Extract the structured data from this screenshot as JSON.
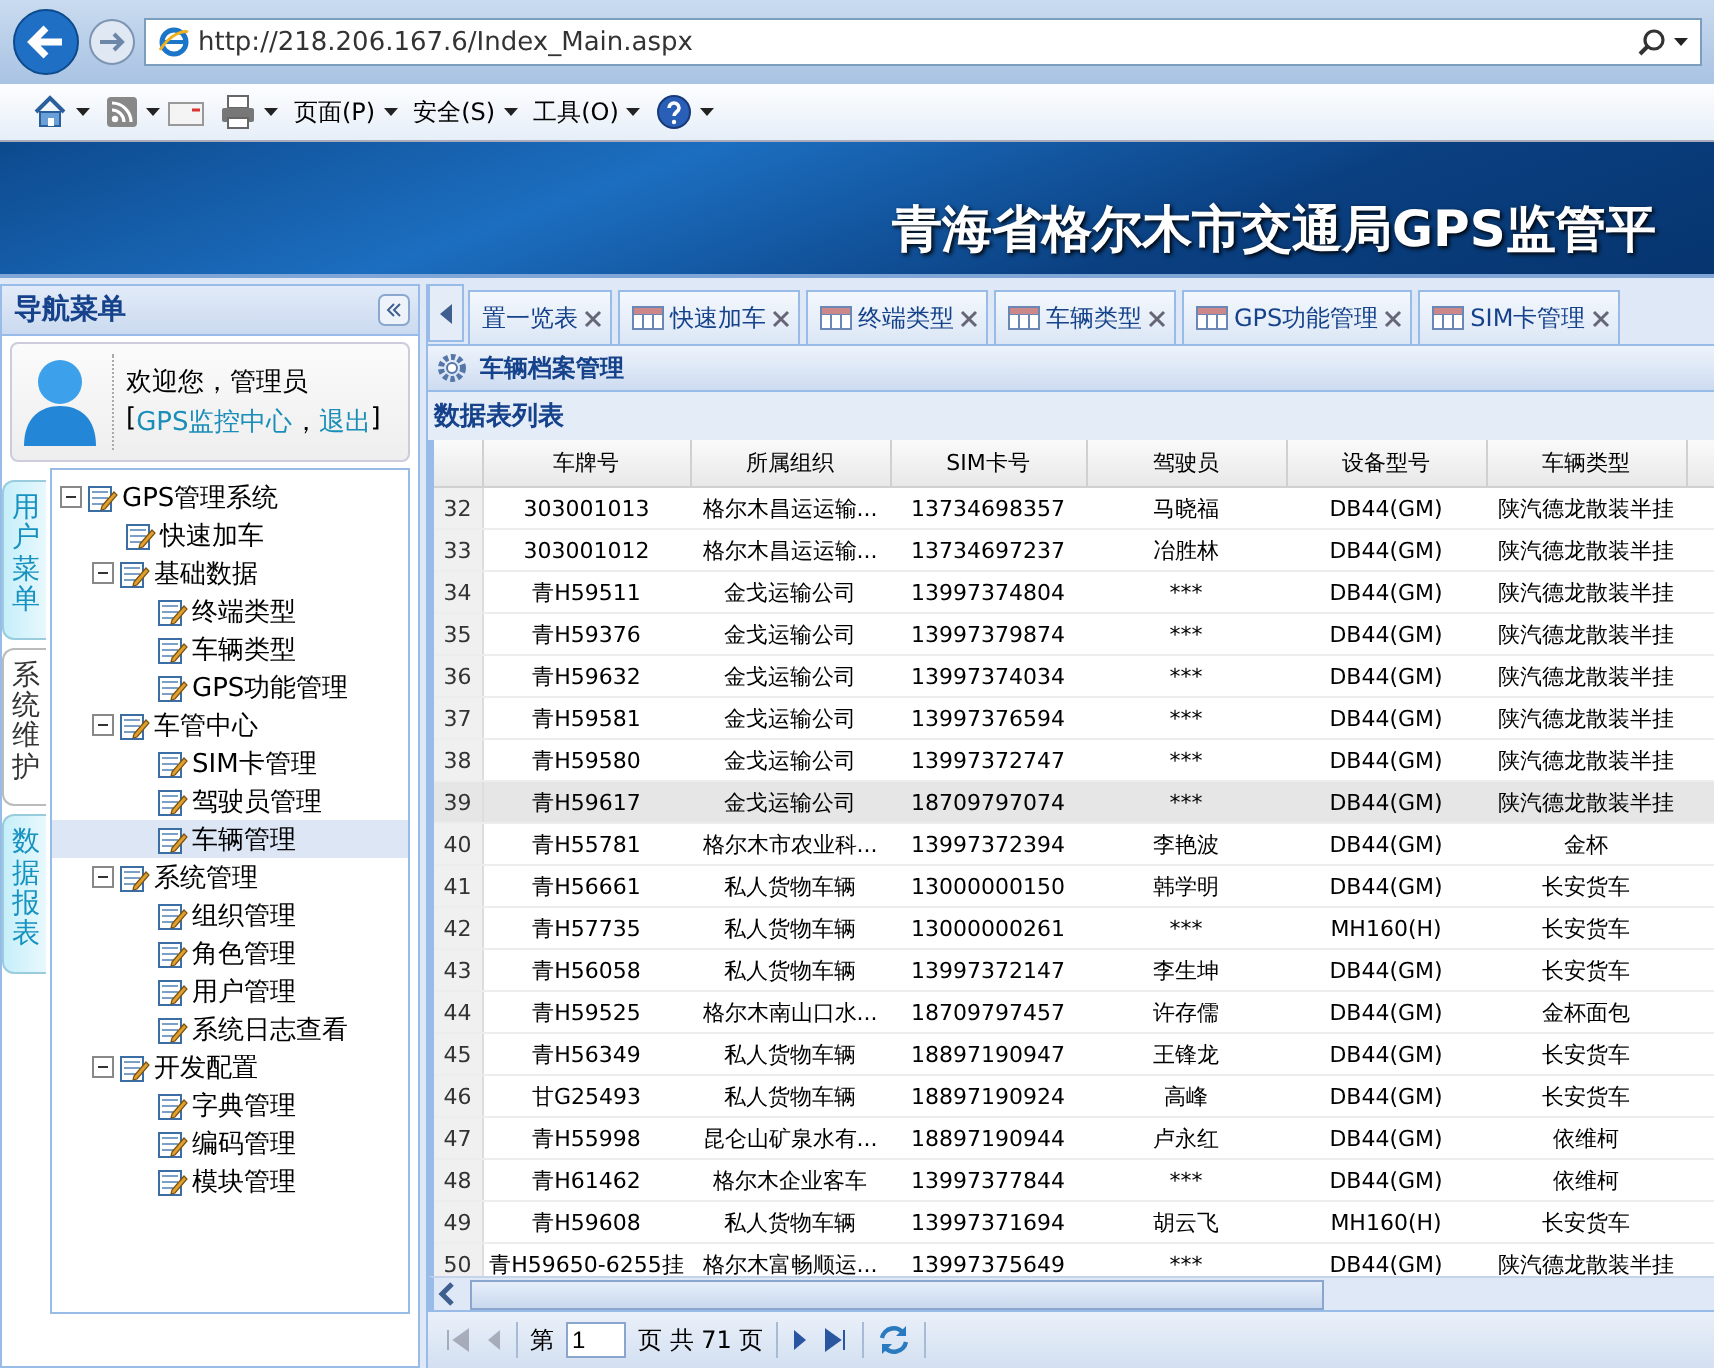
{
  "browser": {
    "url": "http://218.206.167.6/Index_Main.aspx",
    "menus": [
      {
        "label": "页面(P)"
      },
      {
        "label": "安全(S)"
      },
      {
        "label": "工具(O)"
      }
    ]
  },
  "banner": {
    "title": "青海省格尔木市交通局GPS监管平"
  },
  "nav": {
    "title": "导航菜单",
    "greeting": "欢迎您，管理员",
    "bracket_open": "[",
    "center_link": "GPS监控中心",
    "separator": "，",
    "logout_link": "退出",
    "bracket_close": "]",
    "side_tabs": [
      {
        "label": "用户菜单",
        "selected": false
      },
      {
        "label": "系统维护",
        "selected": true
      },
      {
        "label": "数据报表",
        "selected": false
      }
    ],
    "tree": [
      {
        "label": "GPS管理系统",
        "selected": false,
        "expanded": true,
        "children": [
          {
            "label": "快速加车",
            "selected": false
          },
          {
            "label": "基础数据",
            "selected": false,
            "expanded": true,
            "children": [
              {
                "label": "终端类型",
                "selected": false
              },
              {
                "label": "车辆类型",
                "selected": false
              },
              {
                "label": "GPS功能管理",
                "selected": false
              }
            ]
          },
          {
            "label": "车管中心",
            "selected": false,
            "expanded": true,
            "children": [
              {
                "label": "SIM卡管理",
                "selected": false
              },
              {
                "label": "驾驶员管理",
                "selected": false
              },
              {
                "label": "车辆管理",
                "selected": true
              }
            ]
          },
          {
            "label": "系统管理",
            "selected": false,
            "expanded": true,
            "children": [
              {
                "label": "组织管理",
                "selected": false
              },
              {
                "label": "角色管理",
                "selected": false
              },
              {
                "label": "用户管理",
                "selected": false
              },
              {
                "label": "系统日志查看",
                "selected": false
              }
            ]
          },
          {
            "label": "开发配置",
            "selected": false,
            "expanded": true,
            "children": [
              {
                "label": "字典管理",
                "selected": false
              },
              {
                "label": "编码管理",
                "selected": false
              },
              {
                "label": "模块管理",
                "selected": false
              }
            ]
          }
        ]
      }
    ]
  },
  "tabs": [
    {
      "label": "置一览表",
      "selected": false
    },
    {
      "label": "快速加车",
      "selected": false
    },
    {
      "label": "终端类型",
      "selected": false
    },
    {
      "label": "车辆类型",
      "selected": false
    },
    {
      "label": "GPS功能管理",
      "selected": false
    },
    {
      "label": "SIM卡管理",
      "selected": false
    }
  ],
  "panel": {
    "title": "车辆档案管理",
    "subtitle": "数据表列表"
  },
  "table": {
    "columns": [
      "车牌号",
      "所属组织",
      "SIM卡号",
      "驾驶员",
      "设备型号",
      "车辆类型"
    ],
    "rows": [
      {
        "n": "32",
        "selected": false,
        "cells": [
          "303001013",
          "格尔木昌运运输...",
          "13734698357",
          "马晓福",
          "DB44(GM)",
          "陕汽德龙散装半挂"
        ]
      },
      {
        "n": "33",
        "selected": false,
        "cells": [
          "303001012",
          "格尔木昌运运输...",
          "13734697237",
          "冶胜林",
          "DB44(GM)",
          "陕汽德龙散装半挂"
        ]
      },
      {
        "n": "34",
        "selected": false,
        "cells": [
          "青H59511",
          "金戈运输公司",
          "13997374804",
          "***",
          "DB44(GM)",
          "陕汽德龙散装半挂"
        ]
      },
      {
        "n": "35",
        "selected": false,
        "cells": [
          "青H59376",
          "金戈运输公司",
          "13997379874",
          "***",
          "DB44(GM)",
          "陕汽德龙散装半挂"
        ]
      },
      {
        "n": "36",
        "selected": false,
        "cells": [
          "青H59632",
          "金戈运输公司",
          "13997374034",
          "***",
          "DB44(GM)",
          "陕汽德龙散装半挂"
        ]
      },
      {
        "n": "37",
        "selected": false,
        "cells": [
          "青H59581",
          "金戈运输公司",
          "13997376594",
          "***",
          "DB44(GM)",
          "陕汽德龙散装半挂"
        ]
      },
      {
        "n": "38",
        "selected": false,
        "cells": [
          "青H59580",
          "金戈运输公司",
          "13997372747",
          "***",
          "DB44(GM)",
          "陕汽德龙散装半挂"
        ]
      },
      {
        "n": "39",
        "selected": true,
        "cells": [
          "青H59617",
          "金戈运输公司",
          "18709797074",
          "***",
          "DB44(GM)",
          "陕汽德龙散装半挂"
        ]
      },
      {
        "n": "40",
        "selected": false,
        "cells": [
          "青H55781",
          "格尔木市农业科...",
          "13997372394",
          "李艳波",
          "DB44(GM)",
          "金杯"
        ]
      },
      {
        "n": "41",
        "selected": false,
        "cells": [
          "青H56661",
          "私人货物车辆",
          "13000000150",
          "韩学明",
          "DB44(GM)",
          "长安货车"
        ]
      },
      {
        "n": "42",
        "selected": false,
        "cells": [
          "青H57735",
          "私人货物车辆",
          "13000000261",
          "***",
          "MH160(H)",
          "长安货车"
        ]
      },
      {
        "n": "43",
        "selected": false,
        "cells": [
          "青H56058",
          "私人货物车辆",
          "13997372147",
          "李生坤",
          "DB44(GM)",
          "长安货车"
        ]
      },
      {
        "n": "44",
        "selected": false,
        "cells": [
          "青H59525",
          "格尔木南山口水...",
          "18709797457",
          "许存儒",
          "DB44(GM)",
          "金杯面包"
        ]
      },
      {
        "n": "45",
        "selected": false,
        "cells": [
          "青H56349",
          "私人货物车辆",
          "18897190947",
          "王锋龙",
          "DB44(GM)",
          "长安货车"
        ]
      },
      {
        "n": "46",
        "selected": false,
        "cells": [
          "甘G25493",
          "私人货物车辆",
          "18897190924",
          "高峰",
          "DB44(GM)",
          "长安货车"
        ]
      },
      {
        "n": "47",
        "selected": false,
        "cells": [
          "青H55998",
          "昆仑山矿泉水有...",
          "18897190944",
          "卢永红",
          "DB44(GM)",
          "依维柯"
        ]
      },
      {
        "n": "48",
        "selected": false,
        "cells": [
          "青H61462",
          "格尔木企业客车",
          "13997377844",
          "***",
          "DB44(GM)",
          "依维柯"
        ]
      },
      {
        "n": "49",
        "selected": false,
        "cells": [
          "青H59608",
          "私人货物车辆",
          "13997371694",
          "胡云飞",
          "MH160(H)",
          "长安货车"
        ]
      },
      {
        "n": "50",
        "selected": false,
        "cells": [
          "青H59650-6255挂",
          "格尔木富畅顺运...",
          "13997375649",
          "***",
          "DB44(GM)",
          "陕汽德龙散装半挂"
        ]
      }
    ]
  },
  "pager": {
    "before": "第",
    "page": "1",
    "after": "页 共 71 页",
    "first_disabled": true,
    "prev_disabled": true
  }
}
